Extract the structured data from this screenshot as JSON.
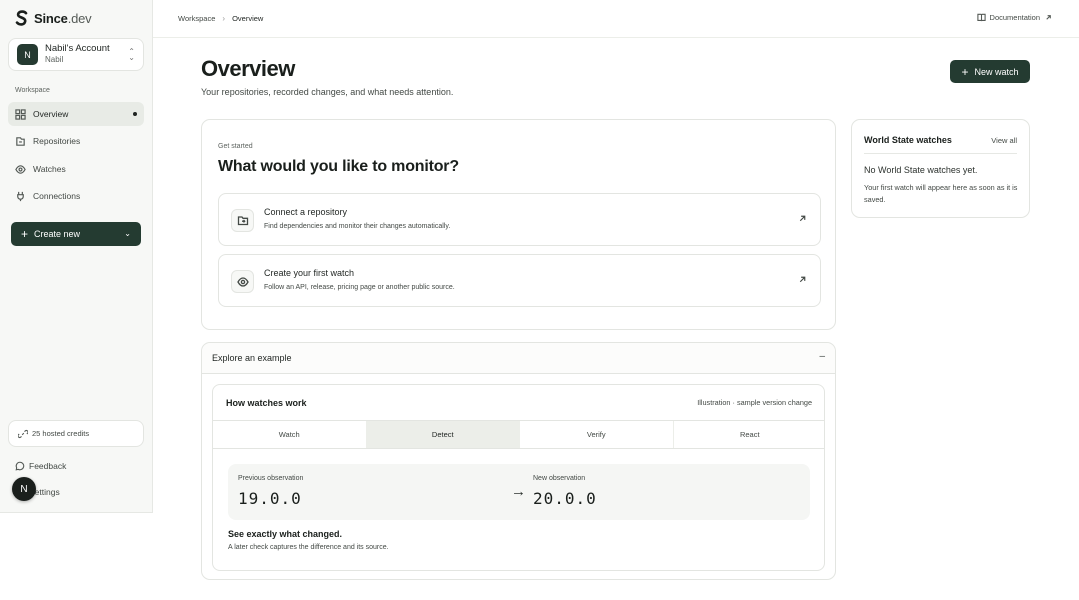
{
  "brand": {
    "name": "Since",
    "suffix": ".dev"
  },
  "account": {
    "initial": "N",
    "name": "Nabil's Account",
    "sub": "Nabil"
  },
  "sidebar": {
    "section_label": "Workspace",
    "items": [
      {
        "label": "Overview",
        "icon": "grid-icon",
        "active": true
      },
      {
        "label": "Repositories",
        "icon": "repo-icon"
      },
      {
        "label": "Watches",
        "icon": "eye-icon"
      },
      {
        "label": "Connections",
        "icon": "plug-icon"
      }
    ],
    "create_label": "Create new",
    "credits": "25 hosted credits",
    "feedback": "Feedback",
    "settings": "Settings",
    "float_initial": "N"
  },
  "topbar": {
    "breadcrumb": [
      "Workspace",
      "Overview"
    ],
    "documentation": "Documentation"
  },
  "header": {
    "title": "Overview",
    "subtitle": "Your repositories, recorded changes, and what needs attention.",
    "new_watch": "New watch"
  },
  "get_started": {
    "eyebrow": "Get started",
    "title": "What would you like to monitor?",
    "options": [
      {
        "title": "Connect a repository",
        "desc": "Find dependencies and monitor their changes automatically.",
        "icon": "repo-link-icon"
      },
      {
        "title": "Create your first watch",
        "desc": "Follow an API, release, pricing page or another public source.",
        "icon": "eye-icon"
      }
    ]
  },
  "world_state": {
    "title": "World State watches",
    "view_all": "View all",
    "empty": "No World State watches yet.",
    "desc": "Your first watch will appear here as soon as it is saved."
  },
  "explore": {
    "label": "Explore an example",
    "toggle": "–",
    "how_title": "How watches work",
    "note": "Illustration · sample version change",
    "steps": [
      "Watch",
      "Detect",
      "Verify",
      "React"
    ],
    "active_step": "Detect",
    "previous_label": "Previous observation",
    "previous_value": "19.0.0",
    "arrow": "→",
    "new_label": "New observation",
    "new_value": "20.0.0",
    "foot_title": "See exactly what changed.",
    "foot_desc": "A later check captures the difference and its source."
  }
}
